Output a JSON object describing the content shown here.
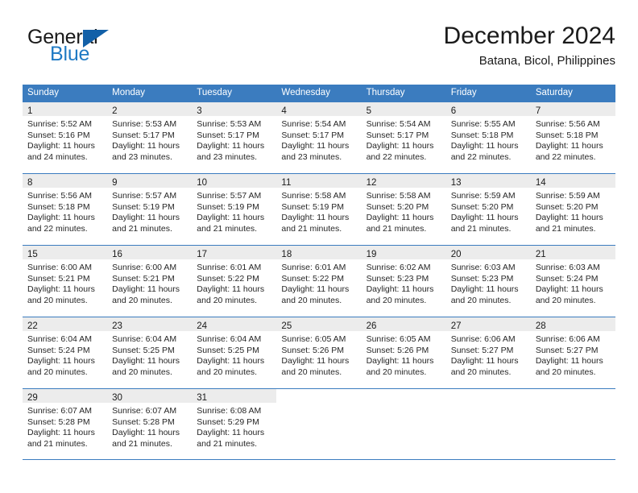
{
  "brand": {
    "word_general": "General",
    "word_blue": "Blue",
    "triangle_color": "#1260a8",
    "blue_color": "#1f7ac4"
  },
  "header": {
    "month_title": "December 2024",
    "location": "Batana, Bicol, Philippines"
  },
  "calendar": {
    "header_bg": "#3b7cbf",
    "day_band_bg": "#ececec",
    "weekdays": [
      "Sunday",
      "Monday",
      "Tuesday",
      "Wednesday",
      "Thursday",
      "Friday",
      "Saturday"
    ],
    "weeks": [
      [
        {
          "day": "1",
          "sunrise": "Sunrise: 5:52 AM",
          "sunset": "Sunset: 5:16 PM",
          "daylight_1": "Daylight: 11 hours",
          "daylight_2": "and 24 minutes."
        },
        {
          "day": "2",
          "sunrise": "Sunrise: 5:53 AM",
          "sunset": "Sunset: 5:17 PM",
          "daylight_1": "Daylight: 11 hours",
          "daylight_2": "and 23 minutes."
        },
        {
          "day": "3",
          "sunrise": "Sunrise: 5:53 AM",
          "sunset": "Sunset: 5:17 PM",
          "daylight_1": "Daylight: 11 hours",
          "daylight_2": "and 23 minutes."
        },
        {
          "day": "4",
          "sunrise": "Sunrise: 5:54 AM",
          "sunset": "Sunset: 5:17 PM",
          "daylight_1": "Daylight: 11 hours",
          "daylight_2": "and 23 minutes."
        },
        {
          "day": "5",
          "sunrise": "Sunrise: 5:54 AM",
          "sunset": "Sunset: 5:17 PM",
          "daylight_1": "Daylight: 11 hours",
          "daylight_2": "and 22 minutes."
        },
        {
          "day": "6",
          "sunrise": "Sunrise: 5:55 AM",
          "sunset": "Sunset: 5:18 PM",
          "daylight_1": "Daylight: 11 hours",
          "daylight_2": "and 22 minutes."
        },
        {
          "day": "7",
          "sunrise": "Sunrise: 5:56 AM",
          "sunset": "Sunset: 5:18 PM",
          "daylight_1": "Daylight: 11 hours",
          "daylight_2": "and 22 minutes."
        }
      ],
      [
        {
          "day": "8",
          "sunrise": "Sunrise: 5:56 AM",
          "sunset": "Sunset: 5:18 PM",
          "daylight_1": "Daylight: 11 hours",
          "daylight_2": "and 22 minutes."
        },
        {
          "day": "9",
          "sunrise": "Sunrise: 5:57 AM",
          "sunset": "Sunset: 5:19 PM",
          "daylight_1": "Daylight: 11 hours",
          "daylight_2": "and 21 minutes."
        },
        {
          "day": "10",
          "sunrise": "Sunrise: 5:57 AM",
          "sunset": "Sunset: 5:19 PM",
          "daylight_1": "Daylight: 11 hours",
          "daylight_2": "and 21 minutes."
        },
        {
          "day": "11",
          "sunrise": "Sunrise: 5:58 AM",
          "sunset": "Sunset: 5:19 PM",
          "daylight_1": "Daylight: 11 hours",
          "daylight_2": "and 21 minutes."
        },
        {
          "day": "12",
          "sunrise": "Sunrise: 5:58 AM",
          "sunset": "Sunset: 5:20 PM",
          "daylight_1": "Daylight: 11 hours",
          "daylight_2": "and 21 minutes."
        },
        {
          "day": "13",
          "sunrise": "Sunrise: 5:59 AM",
          "sunset": "Sunset: 5:20 PM",
          "daylight_1": "Daylight: 11 hours",
          "daylight_2": "and 21 minutes."
        },
        {
          "day": "14",
          "sunrise": "Sunrise: 5:59 AM",
          "sunset": "Sunset: 5:20 PM",
          "daylight_1": "Daylight: 11 hours",
          "daylight_2": "and 21 minutes."
        }
      ],
      [
        {
          "day": "15",
          "sunrise": "Sunrise: 6:00 AM",
          "sunset": "Sunset: 5:21 PM",
          "daylight_1": "Daylight: 11 hours",
          "daylight_2": "and 20 minutes."
        },
        {
          "day": "16",
          "sunrise": "Sunrise: 6:00 AM",
          "sunset": "Sunset: 5:21 PM",
          "daylight_1": "Daylight: 11 hours",
          "daylight_2": "and 20 minutes."
        },
        {
          "day": "17",
          "sunrise": "Sunrise: 6:01 AM",
          "sunset": "Sunset: 5:22 PM",
          "daylight_1": "Daylight: 11 hours",
          "daylight_2": "and 20 minutes."
        },
        {
          "day": "18",
          "sunrise": "Sunrise: 6:01 AM",
          "sunset": "Sunset: 5:22 PM",
          "daylight_1": "Daylight: 11 hours",
          "daylight_2": "and 20 minutes."
        },
        {
          "day": "19",
          "sunrise": "Sunrise: 6:02 AM",
          "sunset": "Sunset: 5:23 PM",
          "daylight_1": "Daylight: 11 hours",
          "daylight_2": "and 20 minutes."
        },
        {
          "day": "20",
          "sunrise": "Sunrise: 6:03 AM",
          "sunset": "Sunset: 5:23 PM",
          "daylight_1": "Daylight: 11 hours",
          "daylight_2": "and 20 minutes."
        },
        {
          "day": "21",
          "sunrise": "Sunrise: 6:03 AM",
          "sunset": "Sunset: 5:24 PM",
          "daylight_1": "Daylight: 11 hours",
          "daylight_2": "and 20 minutes."
        }
      ],
      [
        {
          "day": "22",
          "sunrise": "Sunrise: 6:04 AM",
          "sunset": "Sunset: 5:24 PM",
          "daylight_1": "Daylight: 11 hours",
          "daylight_2": "and 20 minutes."
        },
        {
          "day": "23",
          "sunrise": "Sunrise: 6:04 AM",
          "sunset": "Sunset: 5:25 PM",
          "daylight_1": "Daylight: 11 hours",
          "daylight_2": "and 20 minutes."
        },
        {
          "day": "24",
          "sunrise": "Sunrise: 6:04 AM",
          "sunset": "Sunset: 5:25 PM",
          "daylight_1": "Daylight: 11 hours",
          "daylight_2": "and 20 minutes."
        },
        {
          "day": "25",
          "sunrise": "Sunrise: 6:05 AM",
          "sunset": "Sunset: 5:26 PM",
          "daylight_1": "Daylight: 11 hours",
          "daylight_2": "and 20 minutes."
        },
        {
          "day": "26",
          "sunrise": "Sunrise: 6:05 AM",
          "sunset": "Sunset: 5:26 PM",
          "daylight_1": "Daylight: 11 hours",
          "daylight_2": "and 20 minutes."
        },
        {
          "day": "27",
          "sunrise": "Sunrise: 6:06 AM",
          "sunset": "Sunset: 5:27 PM",
          "daylight_1": "Daylight: 11 hours",
          "daylight_2": "and 20 minutes."
        },
        {
          "day": "28",
          "sunrise": "Sunrise: 6:06 AM",
          "sunset": "Sunset: 5:27 PM",
          "daylight_1": "Daylight: 11 hours",
          "daylight_2": "and 20 minutes."
        }
      ],
      [
        {
          "day": "29",
          "sunrise": "Sunrise: 6:07 AM",
          "sunset": "Sunset: 5:28 PM",
          "daylight_1": "Daylight: 11 hours",
          "daylight_2": "and 21 minutes."
        },
        {
          "day": "30",
          "sunrise": "Sunrise: 6:07 AM",
          "sunset": "Sunset: 5:28 PM",
          "daylight_1": "Daylight: 11 hours",
          "daylight_2": "and 21 minutes."
        },
        {
          "day": "31",
          "sunrise": "Sunrise: 6:08 AM",
          "sunset": "Sunset: 5:29 PM",
          "daylight_1": "Daylight: 11 hours",
          "daylight_2": "and 21 minutes."
        },
        {
          "day": "",
          "sunrise": "",
          "sunset": "",
          "daylight_1": "",
          "daylight_2": ""
        },
        {
          "day": "",
          "sunrise": "",
          "sunset": "",
          "daylight_1": "",
          "daylight_2": ""
        },
        {
          "day": "",
          "sunrise": "",
          "sunset": "",
          "daylight_1": "",
          "daylight_2": ""
        },
        {
          "day": "",
          "sunrise": "",
          "sunset": "",
          "daylight_1": "",
          "daylight_2": ""
        }
      ]
    ]
  }
}
